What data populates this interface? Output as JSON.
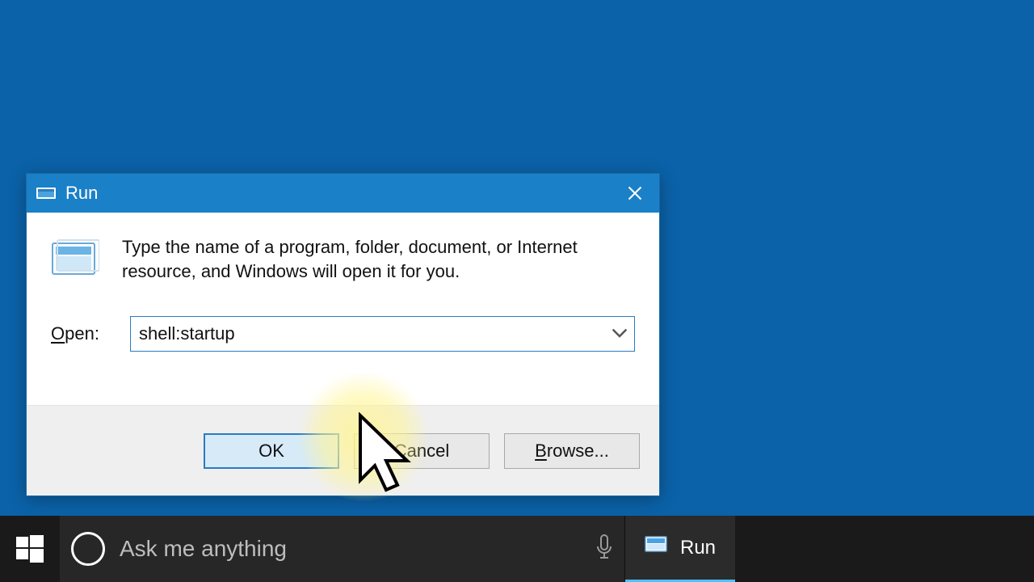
{
  "desktop": {
    "background": "#0b62a8"
  },
  "run": {
    "title": "Run",
    "description": "Type the name of a program, folder, document, or Internet resource, and Windows will open it for you.",
    "open_label_accel": "O",
    "open_label_rest": "pen:",
    "input_value": "shell:startup",
    "buttons": {
      "ok": "OK",
      "cancel": "Cancel",
      "browse_accel": "B",
      "browse_rest": "rowse..."
    }
  },
  "taskbar": {
    "search_placeholder": "Ask me anything",
    "task_label": "Run"
  }
}
